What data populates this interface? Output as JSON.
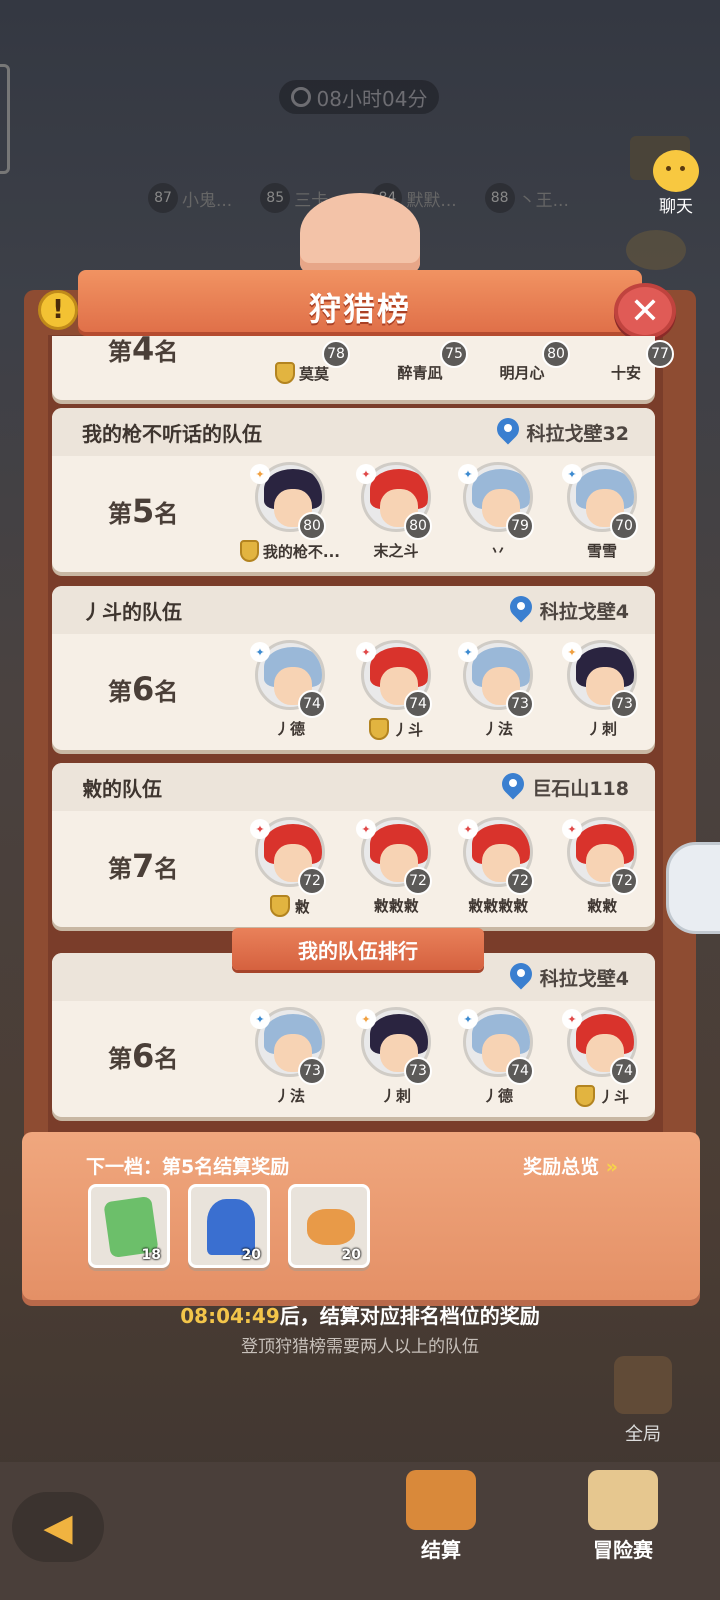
{
  "top": {
    "timer": "08小时04分",
    "ranking_strip": [
      {
        "level": "87",
        "name": "小鬼..."
      },
      {
        "level": "85",
        "name": "三卡..."
      },
      {
        "level": "84",
        "name": "默默..."
      },
      {
        "level": "88",
        "name": "丶王..."
      }
    ],
    "chat_label": "聊天"
  },
  "panel": {
    "title": "狩猎榜",
    "colors": {
      "ribbon": "#e07049",
      "card": "#f6efe6",
      "frame": "#8e4c32"
    }
  },
  "team4": {
    "rank_prefix": "第",
    "rank_num": "4",
    "rank_suffix": "名",
    "members": [
      {
        "level": "78",
        "name": "莫莫",
        "captain": true
      },
      {
        "level": "75",
        "name": "醉青凪",
        "captain": false
      },
      {
        "level": "80",
        "name": "明月心",
        "captain": false
      },
      {
        "level": "77",
        "name": "十安",
        "captain": false
      }
    ]
  },
  "teams": [
    {
      "name": "我的枪不听话的队伍",
      "location": "科拉戈壁32",
      "rank_prefix": "第",
      "rank_num": "5",
      "rank_suffix": "名",
      "members": [
        {
          "level": "80",
          "name": "我的枪不...",
          "captain": true,
          "hair": "#2a2440",
          "cls": "#f0a040"
        },
        {
          "level": "80",
          "name": "末之斗",
          "captain": false,
          "hair": "#d9332c",
          "cls": "#e04848"
        },
        {
          "level": "79",
          "name": "丷",
          "captain": false,
          "hair": "#9ab8d8",
          "cls": "#3c8ad0"
        },
        {
          "level": "70",
          "name": "雪雪",
          "captain": false,
          "hair": "#9ab8d8",
          "cls": "#3c8ad0"
        }
      ]
    },
    {
      "name": "丿斗的队伍",
      "location": "科拉戈壁4",
      "rank_prefix": "第",
      "rank_num": "6",
      "rank_suffix": "名",
      "members": [
        {
          "level": "74",
          "name": "丿德",
          "captain": false,
          "hair": "#9ab8d8",
          "cls": "#3c8ad0"
        },
        {
          "level": "74",
          "name": "丿斗",
          "captain": true,
          "hair": "#d9332c",
          "cls": "#e04848"
        },
        {
          "level": "73",
          "name": "丿法",
          "captain": false,
          "hair": "#9ab8d8",
          "cls": "#3c8ad0"
        },
        {
          "level": "73",
          "name": "丿刺",
          "captain": false,
          "hair": "#2a2440",
          "cls": "#f0a040"
        }
      ]
    },
    {
      "name": "敹的队伍",
      "location": "巨石山118",
      "rank_prefix": "第",
      "rank_num": "7",
      "rank_suffix": "名",
      "members": [
        {
          "level": "72",
          "name": "敹",
          "captain": true,
          "hair": "#d9332c",
          "cls": "#e04848"
        },
        {
          "level": "72",
          "name": "敹敹敹",
          "captain": false,
          "hair": "#d9332c",
          "cls": "#e04848"
        },
        {
          "level": "72",
          "name": "敹敹敹敹",
          "captain": false,
          "hair": "#d9332c",
          "cls": "#e04848"
        },
        {
          "level": "72",
          "name": "敹敹",
          "captain": false,
          "hair": "#d9332c",
          "cls": "#e04848"
        }
      ]
    }
  ],
  "my_team": {
    "ribbon": "我的队伍排行",
    "location": "科拉戈壁4",
    "rank_prefix": "第",
    "rank_num": "6",
    "rank_suffix": "名",
    "members": [
      {
        "level": "73",
        "name": "丿法",
        "captain": false,
        "hair": "#9ab8d8",
        "cls": "#3c8ad0"
      },
      {
        "level": "73",
        "name": "丿刺",
        "captain": false,
        "hair": "#2a2440",
        "cls": "#f0a040"
      },
      {
        "level": "74",
        "name": "丿德",
        "captain": false,
        "hair": "#9ab8d8",
        "cls": "#3c8ad0"
      },
      {
        "level": "74",
        "name": "丿斗",
        "captain": true,
        "hair": "#d9332c",
        "cls": "#e04848"
      }
    ]
  },
  "reward": {
    "title": "下一档：第5名结算奖励",
    "overview": "奖励总览",
    "overview_arrow": "»",
    "items": [
      {
        "icon": "green-ticket-icon",
        "count": "18",
        "color": "#6cbf6a"
      },
      {
        "icon": "blue-crystal-icon",
        "count": "20",
        "color": "#3a6fd0"
      },
      {
        "icon": "food-plate-icon",
        "count": "20",
        "color": "#e89a48"
      }
    ]
  },
  "footer": {
    "countdown": "08:04:49",
    "countdown_suffix": "后，结算对应排名档位的奖励",
    "note": "登顶狩猎榜需要两人以上的队伍",
    "global_label": "全局",
    "back_arrow": "◀",
    "tab_settle": "结算",
    "tab_adventure": "冒险赛"
  }
}
